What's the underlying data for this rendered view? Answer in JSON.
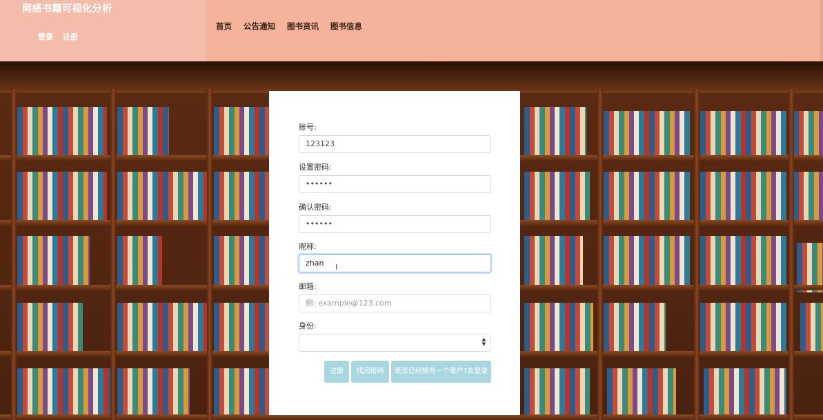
{
  "header": {
    "brand_title": "网络书籍可视化分析",
    "auth": {
      "login": "登录",
      "register": "注册"
    },
    "nav": [
      "首页",
      "公告通知",
      "图书资讯",
      "图书信息"
    ]
  },
  "form": {
    "account": {
      "label": "账号:",
      "value": "123123"
    },
    "password": {
      "label": "设置密码:",
      "value": "••••••"
    },
    "confirm_password": {
      "label": "确认密码:",
      "value": "••••••"
    },
    "nickname": {
      "label": "昵称:",
      "value": "zhan"
    },
    "email": {
      "label": "邮箱:",
      "placeholder": "例: example@123.com"
    },
    "role": {
      "label": "身份:",
      "value": ""
    },
    "buttons": {
      "register": "注册",
      "find_password": "找回密码",
      "have_account": "是否已经拥有一个账户?去登录"
    }
  },
  "colors": {
    "header_bg": "#f4b39a",
    "brand_bg": "#f4bcaa",
    "button_bg": "#a9d7e0",
    "focus_border": "#8fb8e8"
  }
}
